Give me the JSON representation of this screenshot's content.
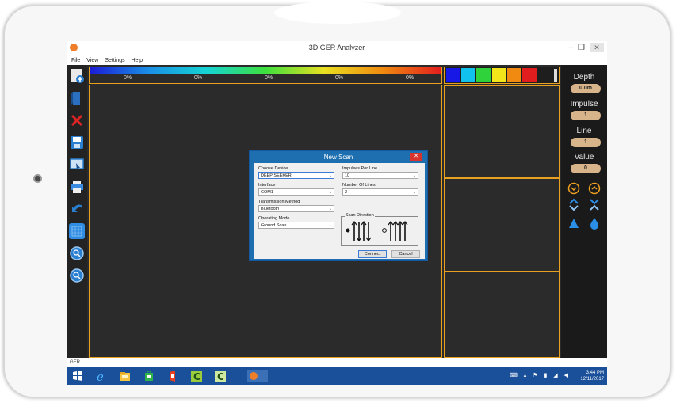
{
  "window": {
    "title": "3D GER Analyzer",
    "close_glyph": "✕",
    "minimize_glyph": "–",
    "restore_glyph": "❐"
  },
  "menu": {
    "items": [
      "File",
      "View",
      "Settings",
      "Help"
    ]
  },
  "colorbar": {
    "percents": [
      "0%",
      "0%",
      "0%",
      "0%",
      "0%"
    ]
  },
  "swatches": [
    "#1717e6",
    "#12c2ee",
    "#2fd23a",
    "#f2e51a",
    "#f08a10",
    "#e21d1d"
  ],
  "right_panel": {
    "depth_label": "Depth",
    "depth_value": "0.0m",
    "impulse_label": "Impulse",
    "impulse_value": "1",
    "line_label": "Line",
    "line_value": "1",
    "value_label": "Value",
    "value_value": "0"
  },
  "status": {
    "text": "GER"
  },
  "taskbar": {
    "time": "3:44 PM",
    "date": "12/11/2017"
  },
  "dialog": {
    "title": "New Scan",
    "close_glyph": "✕",
    "choose_device_label": "Choose Device",
    "choose_device_value": "DEEP SEEKER",
    "interface_label": "Interface",
    "interface_value": "COM1",
    "transmission_label": "Transmission Method",
    "transmission_value": "Bluetooth",
    "operating_mode_label": "Operating Mode",
    "operating_mode_value": "Ground Scan",
    "impulses_label": "Impulses Per Line",
    "impulses_value": "10",
    "lines_label": "Number Of Lines",
    "lines_value": "2",
    "scan_direction_label": "Scan Direction",
    "connect_label": "Connect",
    "cancel_label": "Cancel",
    "dropdown_glyph": "⌄"
  },
  "colors": {
    "accent_orange": "#e8a020",
    "dialog_blue": "#1e6fb0",
    "taskbar_blue": "#1a4f9a"
  }
}
